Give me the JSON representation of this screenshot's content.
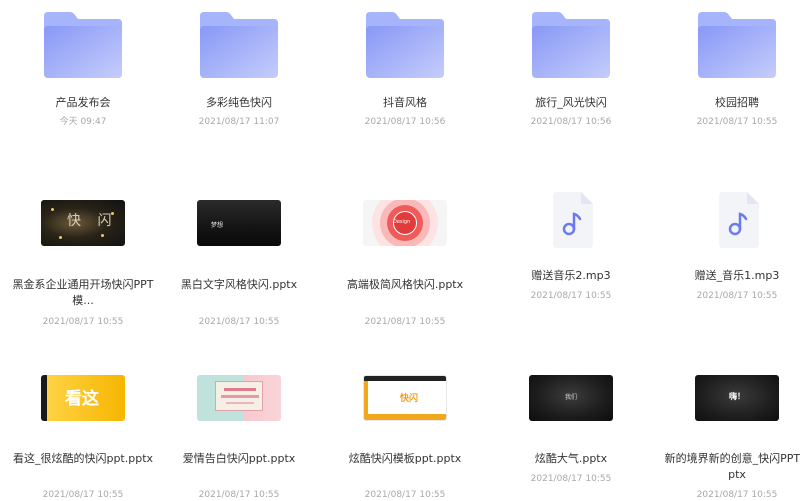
{
  "items": [
    {
      "name": "产品发布会",
      "date": "今天 09:47",
      "type": "folder"
    },
    {
      "name": "多彩纯色快闪",
      "date": "2021/08/17 11:07",
      "type": "folder"
    },
    {
      "name": "抖音风格",
      "date": "2021/08/17 10:56",
      "type": "folder"
    },
    {
      "name": "旅行_风光快闪",
      "date": "2021/08/17 10:56",
      "type": "folder"
    },
    {
      "name": "校园招聘",
      "date": "2021/08/17 10:55",
      "type": "folder"
    },
    {
      "name": "黑金系企业通用开场快闪PPT模...",
      "date": "2021/08/17 10:55",
      "type": "pptx",
      "thumb_text": "快 闪"
    },
    {
      "name": "黑白文字风格快闪.pptx",
      "date": "2021/08/17 10:55",
      "type": "pptx",
      "thumb_text": "梦想"
    },
    {
      "name": "高端极简风格快闪.pptx",
      "date": "2021/08/17 10:55",
      "type": "pptx",
      "thumb_text": "Design"
    },
    {
      "name": "赠送音乐2.mp3",
      "date": "2021/08/17 10:55",
      "type": "mp3"
    },
    {
      "name": "赠送_音乐1.mp3",
      "date": "2021/08/17 10:55",
      "type": "mp3"
    },
    {
      "name": "看这_很炫酷的快闪ppt.pptx",
      "date": "2021/08/17 10:55",
      "type": "pptx",
      "thumb_text": "看这"
    },
    {
      "name": "爱情告白快闪ppt.pptx",
      "date": "2021/08/17 10:55",
      "type": "pptx"
    },
    {
      "name": "炫酷快闪模板ppt.pptx",
      "date": "2021/08/17 10:55",
      "type": "pptx",
      "thumb_text": "快闪"
    },
    {
      "name": "炫酷大气.pptx",
      "date": "2021/08/17 10:55",
      "type": "pptx",
      "thumb_text": "我们"
    },
    {
      "name": "新的境界新的创意_快闪PPT.pptx",
      "date": "2021/08/17 10:55",
      "type": "pptx",
      "thumb_text": "嗨！"
    }
  ],
  "colors": {
    "folder_front": "#8b9bf7",
    "folder_back": "#9fb0fb",
    "music_note": "#6a7bf0"
  }
}
